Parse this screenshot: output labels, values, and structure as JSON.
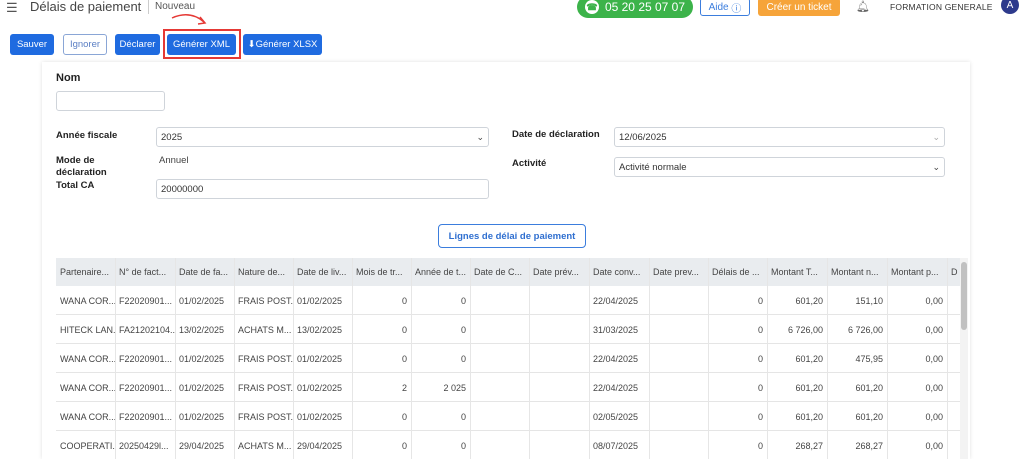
{
  "header": {
    "title": "Délais de paiement",
    "subtitle": "Nouveau",
    "phone": "05 20 25 07 07",
    "help_label": "Aide",
    "ticket_label": "Créer un ticket",
    "user_name": "FORMATION GENERALE",
    "avatar_letter": "A",
    "phone_color": "#3cb34a",
    "ticket_color": "#f6a43a"
  },
  "toolbar": {
    "save_label": "Sauver",
    "ignore_label": "Ignorer",
    "declare_label": "Déclarer",
    "xml_label": "Générer XML",
    "xlsx_label": "Générer XLSX"
  },
  "form": {
    "name_label": "Nom",
    "name_value": "",
    "fiscal_year_label": "Année fiscale",
    "fiscal_year_value": "2025",
    "declaration_mode_label": "Mode de déclaration",
    "declaration_mode_value": "Annuel",
    "total_ca_label": "Total CA",
    "total_ca_value": "20000000",
    "declaration_date_label": "Date de déclaration",
    "declaration_date_value": "12/06/2025",
    "activity_label": "Activité",
    "activity_value": "Activité normale"
  },
  "section_button": "Lignes de délai de paiement",
  "table": {
    "headers": [
      "Partenaire...",
      "N° de fact...",
      "Date de fa...",
      "Nature de...",
      "Date de liv...",
      "Mois de tr...",
      "Année de t...",
      "Date de C...",
      "Date prév...",
      "Date conv...",
      "Date prev...",
      "Délais de ...",
      "Montant T...",
      "Montant n...",
      "Montant p...",
      "D"
    ],
    "rows": [
      [
        "WANA COR...",
        "F22020901...",
        "01/02/2025",
        "FRAIS POST...",
        "01/02/2025",
        "0",
        "0",
        "",
        "",
        "22/04/2025",
        "",
        "0",
        "601,20",
        "151,10",
        "0,00"
      ],
      [
        "HITECK LAN...",
        "FA21202104...",
        "13/02/2025",
        "ACHATS M...",
        "13/02/2025",
        "0",
        "0",
        "",
        "",
        "31/03/2025",
        "",
        "0",
        "6 726,00",
        "6 726,00",
        "0,00"
      ],
      [
        "WANA COR...",
        "F22020901...",
        "01/02/2025",
        "FRAIS POST...",
        "01/02/2025",
        "0",
        "0",
        "",
        "",
        "22/04/2025",
        "",
        "0",
        "601,20",
        "475,95",
        "0,00"
      ],
      [
        "WANA COR...",
        "F22020901...",
        "01/02/2025",
        "FRAIS POST...",
        "01/02/2025",
        "2",
        "2 025",
        "",
        "",
        "22/04/2025",
        "",
        "0",
        "601,20",
        "601,20",
        "0,00"
      ],
      [
        "WANA COR...",
        "F22020901...",
        "01/02/2025",
        "FRAIS POST...",
        "01/02/2025",
        "0",
        "0",
        "",
        "",
        "02/05/2025",
        "",
        "0",
        "601,20",
        "601,20",
        "0,00"
      ],
      [
        "COOPERATI...",
        "20250429l...",
        "29/04/2025",
        "ACHATS M...",
        "29/04/2025",
        "0",
        "0",
        "",
        "",
        "08/07/2025",
        "",
        "0",
        "268,27",
        "268,27",
        "0,00"
      ]
    ]
  }
}
